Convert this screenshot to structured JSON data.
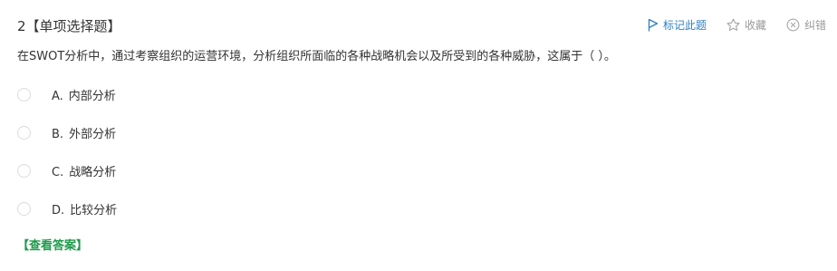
{
  "question": {
    "number": "2",
    "type": "【单项选择题】",
    "stem": "在SWOT分析中，通过考察组织的运营环境，分析组织所面临的各种战略机会以及所受到的各种威胁，这属于（    ）。"
  },
  "toolbar": {
    "mark_label": "标记此题",
    "fav_label": "收藏",
    "report_label": "纠错"
  },
  "options": [
    {
      "letter": "A.",
      "text": "内部分析"
    },
    {
      "letter": "B.",
      "text": "外部分析"
    },
    {
      "letter": "C.",
      "text": "战略分析"
    },
    {
      "letter": "D.",
      "text": "比较分析"
    }
  ],
  "answer_link": "【查看答案】",
  "colors": {
    "accent_blue": "#2d7fc1",
    "answer_green": "#1f9a4b",
    "muted_gray": "#999999"
  },
  "icons": {
    "mark": "flag-icon",
    "fav": "star-icon",
    "report": "circle-x-icon"
  }
}
